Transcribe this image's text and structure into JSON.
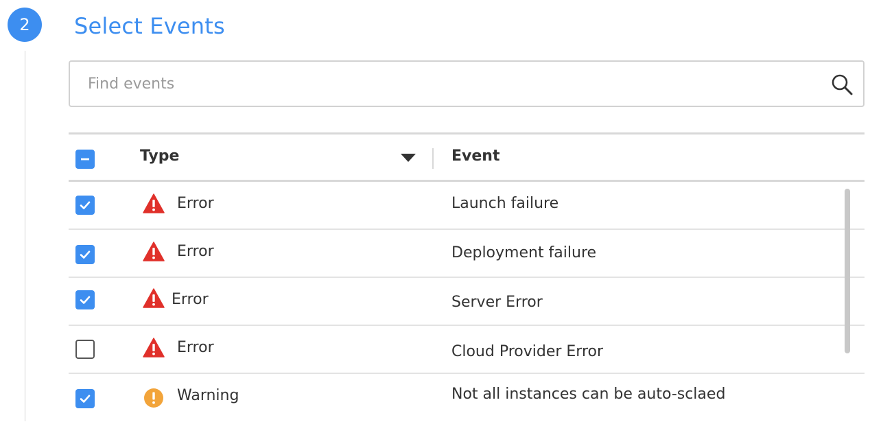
{
  "step": {
    "number": "2",
    "title": "Select Events"
  },
  "search": {
    "placeholder": "Find events",
    "value": "",
    "icon": "search-icon"
  },
  "table": {
    "select_all_state": "indeterminate",
    "columns": {
      "type": "Type",
      "event": "Event"
    },
    "sort_icon": "caret-down-icon",
    "rows": [
      {
        "checked": true,
        "type": "Error",
        "icon": "error-triangle-icon",
        "event": "Launch failure"
      },
      {
        "checked": true,
        "type": "Error",
        "icon": "error-triangle-icon",
        "event": "Deployment failure"
      },
      {
        "checked": true,
        "type": "Error",
        "icon": "error-triangle-icon",
        "event": "Server Error"
      },
      {
        "checked": false,
        "type": "Error",
        "icon": "error-triangle-icon",
        "event": "Cloud Provider Error"
      },
      {
        "checked": true,
        "type": "Warning",
        "icon": "warning-circle-icon",
        "event": "Not all instances can be auto-sclaed"
      }
    ]
  },
  "colors": {
    "accent": "#3d8ef0",
    "error": "#e0302a",
    "warning": "#f2a43a"
  }
}
